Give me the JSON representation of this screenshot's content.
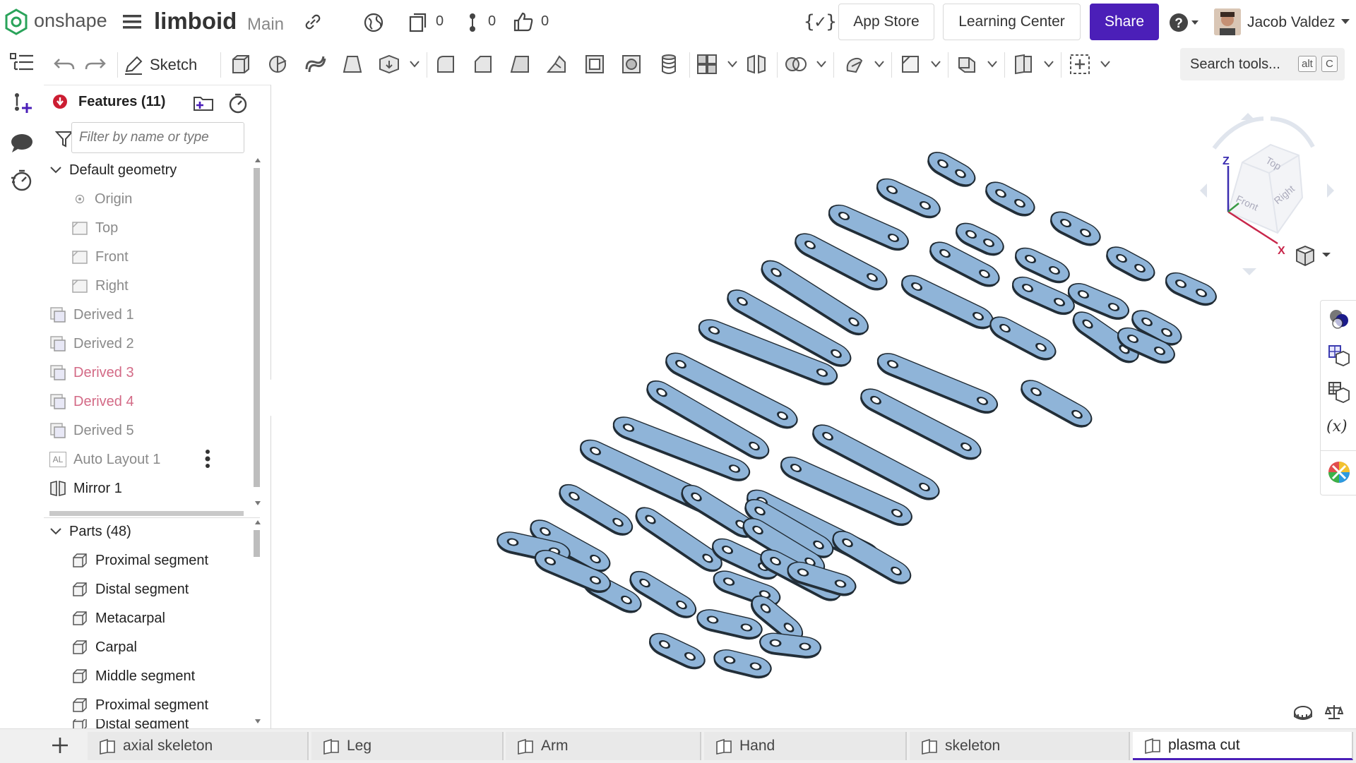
{
  "app": {
    "brand": "onshape",
    "document_name": "limboid",
    "branch": "Main"
  },
  "header": {
    "versions_count": "0",
    "branches_count": "0",
    "likes_count": "0",
    "app_store_label": "App Store",
    "learning_center_label": "Learning Center",
    "share_label": "Share",
    "user_name": "Jacob Valdez"
  },
  "toolbar": {
    "sketch_label": "Sketch",
    "search_label": "Search tools...",
    "search_shortcut_alt": "alt",
    "search_shortcut_key": "C"
  },
  "features": {
    "title": "Features (11)",
    "filter_placeholder": "Filter by name or type",
    "default_geometry_label": "Default geometry",
    "items": [
      {
        "label": "Origin"
      },
      {
        "label": "Top"
      },
      {
        "label": "Front"
      },
      {
        "label": "Right"
      },
      {
        "label": "Derived 1"
      },
      {
        "label": "Derived 2"
      },
      {
        "label": "Derived 3"
      },
      {
        "label": "Derived 4"
      },
      {
        "label": "Derived 5"
      },
      {
        "label": "Auto Layout 1"
      },
      {
        "label": "Mirror 1"
      }
    ],
    "auto_layout_badge": "AL"
  },
  "parts": {
    "title": "Parts (48)",
    "items": [
      {
        "label": "Proximal segment"
      },
      {
        "label": "Distal segment"
      },
      {
        "label": "Metacarpal"
      },
      {
        "label": "Carpal"
      },
      {
        "label": "Middle segment"
      },
      {
        "label": "Proximal segment"
      },
      {
        "label": "Distal segment"
      }
    ]
  },
  "view_cube": {
    "top": "Top",
    "front": "Front",
    "right": "Right",
    "axis_x": "X",
    "axis_z": "Z"
  },
  "tabs": [
    {
      "label": "axial skeleton"
    },
    {
      "label": "Leg"
    },
    {
      "label": "Arm"
    },
    {
      "label": "Hand"
    },
    {
      "label": "skeleton"
    },
    {
      "label": "plasma cut"
    }
  ],
  "colors": {
    "accent": "#4b1fb8",
    "part_fill": "#8fb4d8",
    "part_edge": "#1f2a33",
    "derived_pink": "#d36a86"
  }
}
